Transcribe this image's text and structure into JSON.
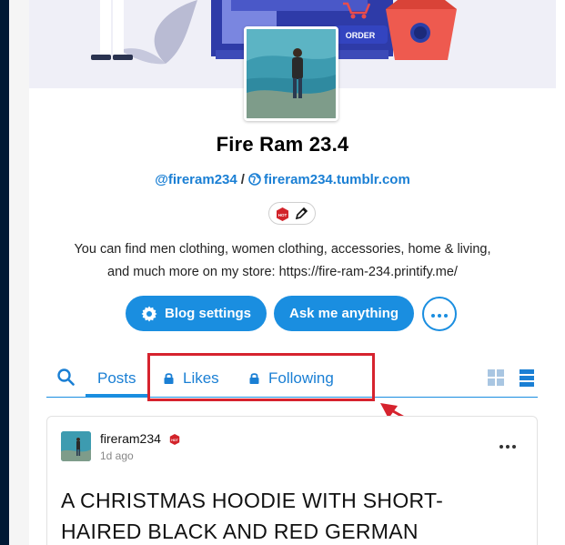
{
  "banner": {
    "order_label": "ORDER"
  },
  "blog": {
    "title": "Fire Ram 23.4",
    "handle": "@fireram234",
    "separator": "/",
    "url": "fireram234.tumblr.com",
    "badge_text": "HOT",
    "description_line1": "You can find men clothing, women clothing, accessories, home & living,",
    "description_line2": "and much more on my store: https://fire-ram-234.printify.me/"
  },
  "actions": {
    "settings_label": "Blog settings",
    "ask_label": "Ask me anything"
  },
  "tabs": [
    {
      "label": "Posts",
      "active": true,
      "locked": false
    },
    {
      "label": "Likes",
      "active": false,
      "locked": true
    },
    {
      "label": "Following",
      "active": false,
      "locked": true
    }
  ],
  "post": {
    "username": "fireram234",
    "time": "1d ago",
    "title_line1": "A CHRISTMAS HOODIE WITH SHORT-",
    "title_line2": "HAIRED BLACK AND RED GERMAN"
  },
  "colors": {
    "accent": "#1a8ee0",
    "annotation": "#d6232e",
    "sidebar": "#001935"
  },
  "icons": [
    "search-icon",
    "lock-icon",
    "gear-icon",
    "globe-icon",
    "pencil-icon",
    "more-icon",
    "grid-view-icon",
    "list-view-icon"
  ]
}
